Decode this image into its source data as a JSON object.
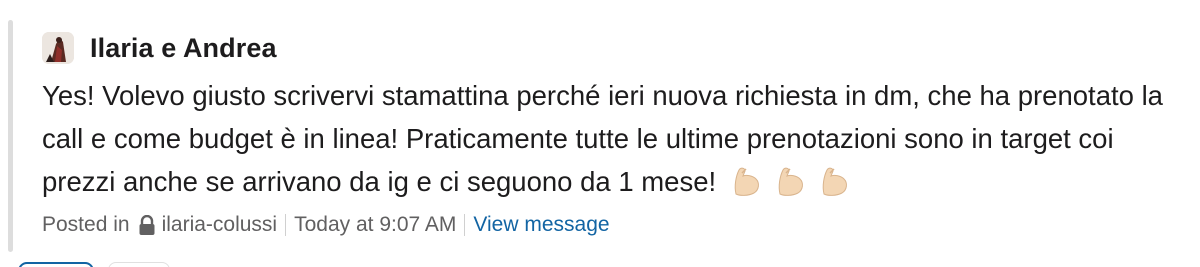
{
  "message": {
    "author": "Ilaria e Andrea",
    "avatar_icon": "profile-photo",
    "text": "Yes! Volevo giusto scrivervi stamattina perché ieri nuova richiesta in dm, che ha prenotato la call e come budget è in linea! Praticamente tutte le ultime prenotazioni sono in target coi prezzi anche se arrivano da ig e ci seguono da 1 mese!",
    "reactions_inline": [
      "flexed-biceps-emoji",
      "flexed-biceps-emoji",
      "flexed-biceps-emoji"
    ]
  },
  "footer": {
    "posted_in_label": "Posted in",
    "channel_icon": "lock-icon",
    "channel": "ilaria-colussi",
    "timestamp": "Today at 9:07 AM",
    "view_link": "View message"
  },
  "colors": {
    "link": "#1264a3",
    "meta_text": "#616061",
    "quote_bar": "#dddddd",
    "emoji_skin": "#f3d6b4"
  }
}
